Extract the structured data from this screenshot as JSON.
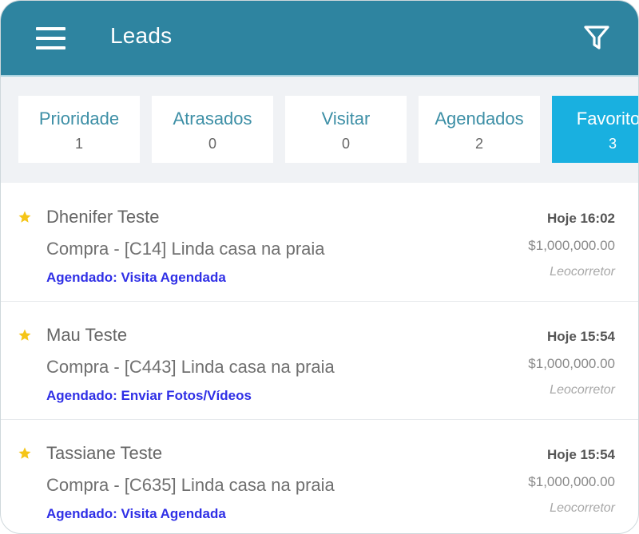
{
  "header": {
    "title": "Leads",
    "menu_icon": "hamburger-menu-icon",
    "filter_icon": "filter-funnel-icon",
    "background_color": "#2e84a0"
  },
  "tabs": [
    {
      "label": "Prioridade",
      "count": "1",
      "active": false
    },
    {
      "label": "Atrasados",
      "count": "0",
      "active": false
    },
    {
      "label": "Visitar",
      "count": "0",
      "active": false
    },
    {
      "label": "Agendados",
      "count": "2",
      "active": false
    },
    {
      "label": "Favoritos",
      "count": "3",
      "active": true
    }
  ],
  "leads": [
    {
      "name": "Dhenifer Teste",
      "description": "Compra - [C14] Linda casa na praia",
      "status": "Agendado: Visita Agendada",
      "time": "Hoje 16:02",
      "price": "$1,000,000.00",
      "agent": "Leocorretor",
      "favorite": true
    },
    {
      "name": "Mau Teste",
      "description": "Compra - [C443] Linda casa na praia",
      "status": "Agendado: Enviar Fotos/Vídeos",
      "time": "Hoje 15:54",
      "price": "$1,000,000.00",
      "agent": "Leocorretor",
      "favorite": true
    },
    {
      "name": "Tassiane Teste",
      "description": "Compra - [C635] Linda casa na praia",
      "status": "Agendado: Visita Agendada",
      "time": "Hoje 15:54",
      "price": "$1,000,000.00",
      "agent": "Leocorretor",
      "favorite": true
    }
  ],
  "colors": {
    "accent": "#19b0e0",
    "tab_text": "#3d8fa6",
    "status_text": "#2f2fe6",
    "star": "#f5c518"
  }
}
